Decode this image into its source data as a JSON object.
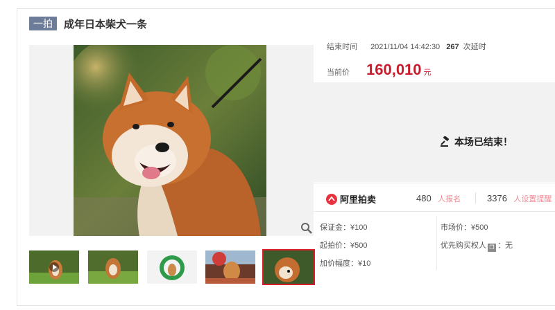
{
  "item": {
    "tag": "一拍",
    "title": "成年日本柴犬一条"
  },
  "auction": {
    "end_label": "结束时间",
    "end_time": "2021/11/04 14:42:30",
    "delay_count": "267",
    "delay_label": "次延时",
    "price_label": "当前价",
    "price": "160,010",
    "price_unit": "元",
    "status": "本场已结束！"
  },
  "platform": {
    "name": "阿里拍卖",
    "brand_color": "#e8313f"
  },
  "stats": {
    "registered_count": "480",
    "registered_label": "人报名",
    "reminder_count": "3376",
    "reminder_label": "人设置提醒"
  },
  "details": {
    "deposit": "保证金：¥100",
    "start_price": "起拍价：¥500",
    "increment": "加价幅度：¥10",
    "market_price": "市场价：¥500",
    "priority_prefix": "优先购买权人",
    "priority_badge": "❐",
    "priority_value": "：无"
  },
  "gallery": {
    "thumbnail_count": 5,
    "selected_index": 4
  },
  "colors": {
    "accent_red": "#c81c2c",
    "tag_bg": "#6d7d99",
    "selected_border": "#d8202d"
  }
}
